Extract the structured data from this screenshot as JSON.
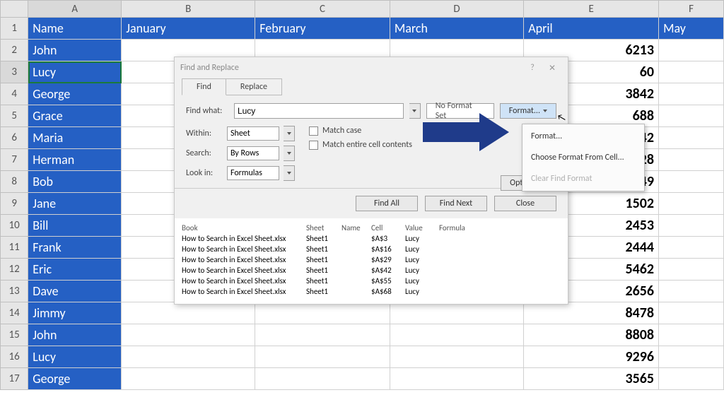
{
  "colors": {
    "header_bg": "#2560c4",
    "accent": "#1f3b8a"
  },
  "columns": [
    "A",
    "B",
    "C",
    "D",
    "E",
    "F"
  ],
  "header_row": [
    "Name",
    "January",
    "February",
    "March",
    "April",
    "May"
  ],
  "rows": [
    1,
    2,
    3,
    4,
    5,
    6,
    7,
    8,
    9,
    10,
    11,
    12,
    13,
    14,
    15,
    16,
    17
  ],
  "names": [
    "John",
    "Lucy",
    "George",
    "Grace",
    "Maria",
    "Herman",
    "Bob",
    "Jane",
    "Bill",
    "Frank",
    "Eric",
    "Dave",
    "Jimmy",
    "John",
    "Lucy",
    "George"
  ],
  "april_vals": [
    "6213",
    "60",
    "3842",
    "688",
    "942",
    "828",
    "1149",
    "1502",
    "2453",
    "2444",
    "5462",
    "2656",
    "8478",
    "8808",
    "9296",
    "3565"
  ],
  "selected_cell": "A3",
  "dialog": {
    "title": "Find and Replace",
    "tabs": {
      "find": "Find",
      "replace": "Replace",
      "active": "find"
    },
    "find_what_label": "Find what:",
    "find_what_value": "Lucy",
    "no_format_label": "No Format Set",
    "format_button_label": "Format...",
    "underline_keys": {
      "find": "d",
      "replace": "p",
      "findwhat": "n"
    },
    "within": {
      "label": "Within:",
      "value": "Sheet"
    },
    "search": {
      "label": "Search:",
      "value": "By Rows"
    },
    "lookin": {
      "label": "Look in:",
      "value": "Formulas"
    },
    "match_case": "Match case",
    "match_entire": "Match entire cell contents",
    "options_button": "Options <<",
    "buttons": {
      "find_all": "Find All",
      "find_next": "Find Next",
      "close": "Close"
    }
  },
  "format_menu": {
    "format": "Format...",
    "from_cell": "Choose Format From Cell...",
    "clear": "Clear Find Format"
  },
  "results": {
    "headers": [
      "Book",
      "Sheet",
      "Name",
      "Cell",
      "Value",
      "Formula"
    ],
    "rows": [
      {
        "book": "How to Search in Excel Sheet.xlsx",
        "sheet": "Sheet1",
        "name": "",
        "cell": "$A$3",
        "value": "Lucy",
        "formula": ""
      },
      {
        "book": "How to Search in Excel Sheet.xlsx",
        "sheet": "Sheet1",
        "name": "",
        "cell": "$A$16",
        "value": "Lucy",
        "formula": ""
      },
      {
        "book": "How to Search in Excel Sheet.xlsx",
        "sheet": "Sheet1",
        "name": "",
        "cell": "$A$29",
        "value": "Lucy",
        "formula": ""
      },
      {
        "book": "How to Search in Excel Sheet.xlsx",
        "sheet": "Sheet1",
        "name": "",
        "cell": "$A$42",
        "value": "Lucy",
        "formula": ""
      },
      {
        "book": "How to Search in Excel Sheet.xlsx",
        "sheet": "Sheet1",
        "name": "",
        "cell": "$A$55",
        "value": "Lucy",
        "formula": ""
      },
      {
        "book": "How to Search in Excel Sheet.xlsx",
        "sheet": "Sheet1",
        "name": "",
        "cell": "$A$68",
        "value": "Lucy",
        "formula": ""
      }
    ]
  }
}
